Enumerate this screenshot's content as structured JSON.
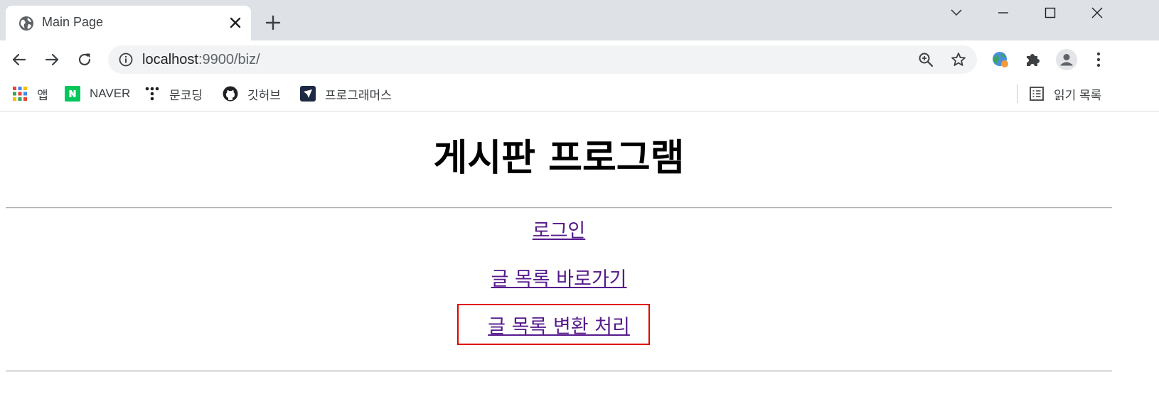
{
  "browser": {
    "tab": {
      "title": "Main Page",
      "icon": "globe-icon"
    },
    "address_bar": {
      "host": "localhost",
      "rest": ":9900/biz/"
    },
    "bookmarks": [
      {
        "label": "앱",
        "icon": "apps-grid-icon"
      },
      {
        "label": "NAVER",
        "icon": "naver-icon"
      },
      {
        "label": "문코딩",
        "icon": "dots-icon"
      },
      {
        "label": "깃허브",
        "icon": "github-icon"
      },
      {
        "label": "프로그래머스",
        "icon": "programmers-icon"
      }
    ],
    "reading_list": {
      "label": "읽기 목록",
      "icon": "reading-list-icon"
    }
  },
  "page": {
    "title": "게시판 프로그램",
    "links": [
      {
        "label": "로그인"
      },
      {
        "label": "글 목록 바로가기"
      },
      {
        "label": "글 목록 변환 처리",
        "highlighted": true
      }
    ]
  },
  "colors": {
    "link_visited": "#551a8b",
    "highlight_border": "#e00000",
    "tabstrip_bg": "#dee1e6",
    "omnibox_bg": "#f1f3f4"
  }
}
